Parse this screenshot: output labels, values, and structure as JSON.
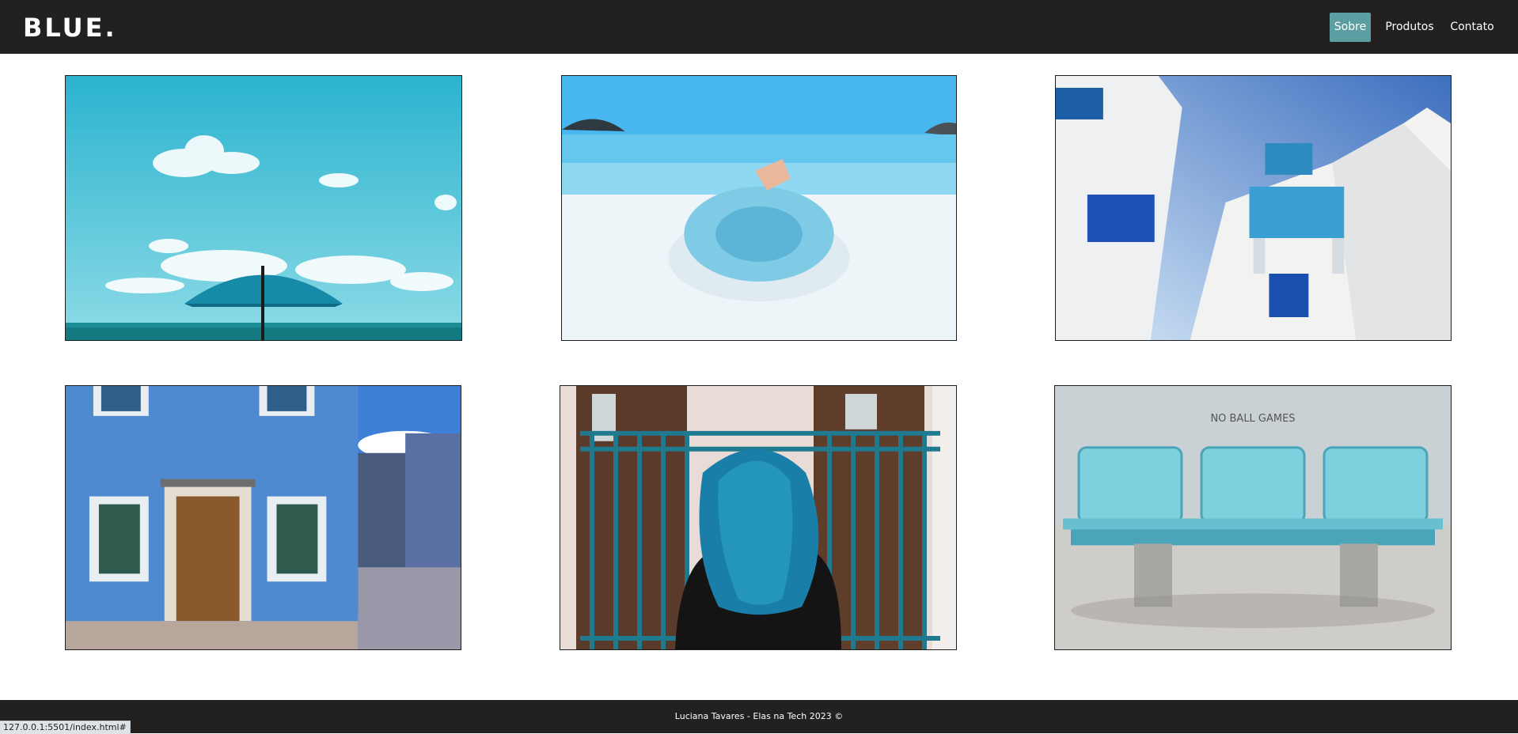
{
  "header": {
    "logo": "BLUE.",
    "nav": [
      {
        "label": "Sobre",
        "active": true
      },
      {
        "label": "Produtos",
        "active": false
      },
      {
        "label": "Contato",
        "active": false
      }
    ]
  },
  "gallery": [
    {
      "subject": "beach umbrella under blue sky"
    },
    {
      "subject": "person with blue hat on white beach"
    },
    {
      "subject": "white building with blue balconies"
    },
    {
      "subject": "blue house facade with wooden door"
    },
    {
      "subject": "woman with blue hair at railing"
    },
    {
      "subject": "light blue bench seats"
    }
  ],
  "footer": {
    "text": "Luciana Tavares - Elas na Tech 2023 ©"
  },
  "status_bar": {
    "url": "127.0.0.1:5501/index.html#"
  },
  "colors": {
    "header_bg": "#232120",
    "accent": "#5c9ea1",
    "text_light": "#ffffff"
  }
}
